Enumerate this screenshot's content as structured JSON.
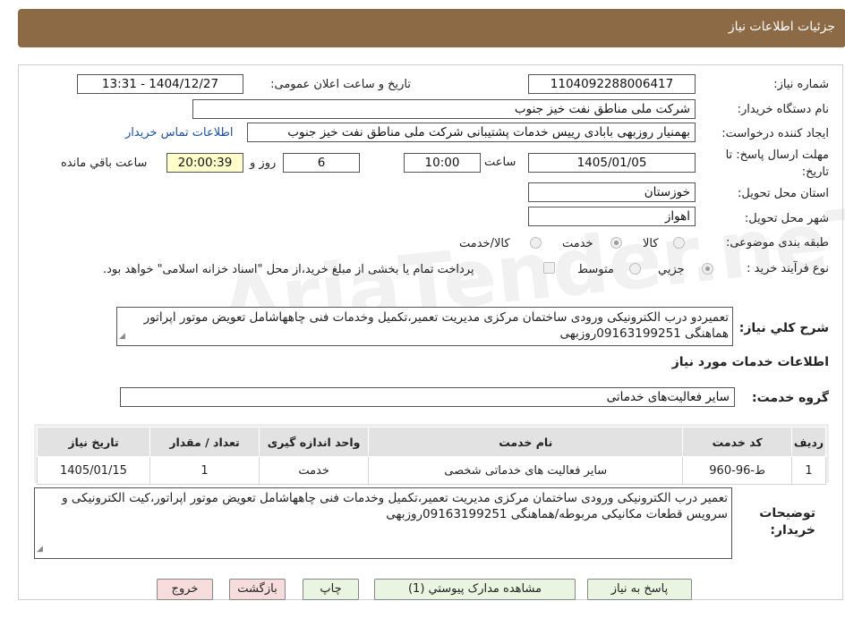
{
  "header": {
    "title": "جزئیات اطلاعات نیاز"
  },
  "fields": {
    "need_number_label": "شماره نیاز:",
    "need_number_value": "1104092288006417",
    "announce_label": "تاریخ و ساعت اعلان عمومی:",
    "announce_value": "1404/12/27 - 13:31",
    "buyer_org_label": "نام دستگاه خریدار:",
    "buyer_org_value": "شرکت ملی مناطق نفت خیز جنوب",
    "requester_label": "ایجاد کننده درخواست:",
    "requester_value": "بهمنیار روزبهی بابادی رییس خدمات پشتیبانی شرکت ملی مناطق نفت خیز جنوب",
    "contact_link": "اطلاعات تماس خریدار",
    "deadline_label_1": "مهلت ارسال پاسخ: تا",
    "deadline_label_2": "تاریخ:",
    "deadline_date": "1405/01/05",
    "time_label": "ساعت",
    "deadline_time": "10:00",
    "days_value": "6",
    "days_label": "روز و",
    "remaining_time": "20:00:39",
    "remaining_label": "ساعت باقي مانده",
    "province_label": "استان محل تحویل:",
    "province_value": "خوزستان",
    "city_label": "شهر محل تحویل:",
    "city_value": "اهواز",
    "category_label": "طبقه بندی موضوعی:",
    "category_options": [
      "كالا",
      "خدمت",
      "كالا/خدمت"
    ],
    "category_selected": "خدمت",
    "process_label": "نوع فرآیند خرید :",
    "process_options": [
      "جزيي",
      "متوسط"
    ],
    "process_selected": "جزيي",
    "treasury_note": "پرداخت تمام یا بخشی از مبلغ خرید،از محل \"اسناد خزانه اسلامی\" خواهد بود.",
    "description_label": "شرح كلي نياز:",
    "description_value": "تعمیردو درب الکترونیکی ورودی ساختمان مرکزی مدیریت تعمیر،تکمیل وخدمات فنی چاهها‌شامل تعویض موتور اپراتور هماهنگی 09163199251روزبهی"
  },
  "services": {
    "section_title": "اطلاعات خدمات مورد نیاز",
    "group_label": "گروه خدمت:",
    "group_value": "سایر فعالیت‌های خدماتی",
    "columns": [
      "رديف",
      "كد خدمت",
      "نام خدمت",
      "واحد اندازه گیری",
      "تعداد / مقدار",
      "تاريخ نياز"
    ],
    "rows": [
      [
        "1",
        "ط-96-960",
        "سایر فعالیت های خدماتی شخصی",
        "خدمت",
        "1",
        "1405/01/15"
      ]
    ]
  },
  "buyer_notes": {
    "label_1": "توضیحات",
    "label_2": "خریدار:",
    "value": "تعمیر درب الکترونیکی ورودی ساختمان مرکزی مدیریت تعمیر،تکمیل وخدمات فنی چاهها‌شامل تعویض موتور اپراتور،کیت الکترونیکی و سرویس قطعات مکانیکی مربوطه/هماهنگی 09163199251روزبهی"
  },
  "buttons": {
    "reply": "پاسخ به نیاز",
    "attachments": "مشاهده مدارک پیوستي (1)",
    "print": "چاپ",
    "back": "بازگشت",
    "exit": "خروج"
  },
  "watermark_text": "AriaTender.neT"
}
